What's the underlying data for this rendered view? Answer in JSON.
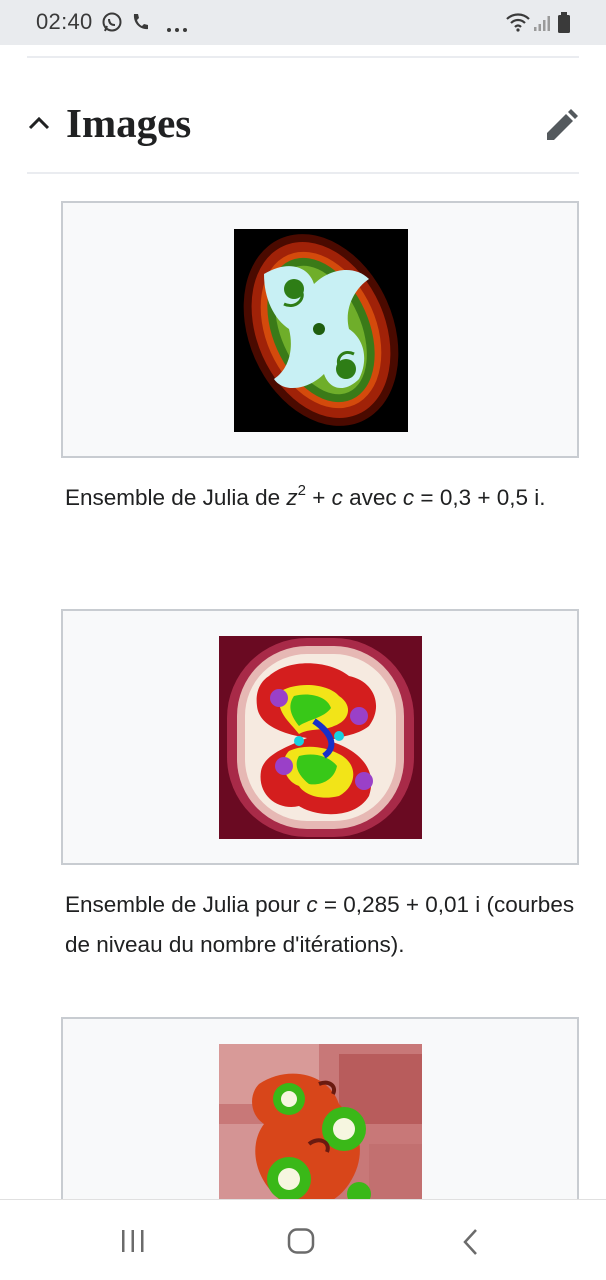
{
  "status_bar": {
    "time": "02:40",
    "icons": [
      "whatsapp-icon",
      "phone-icon",
      "more-dots-icon",
      "wifi-icon",
      "signal-icon",
      "battery-icon"
    ]
  },
  "section": {
    "title": "Images",
    "collapse_icon": "chevron-up-icon",
    "edit_icon": "pencil-icon"
  },
  "gallery": [
    {
      "image": "julia-set-1",
      "caption_parts": [
        "Ensemble de Julia de ",
        "z",
        "2",
        " + ",
        "c",
        " avec ",
        "c",
        " = 0,3 + 0,5 i."
      ]
    },
    {
      "image": "julia-set-2",
      "caption_parts": [
        "Ensemble de Julia pour ",
        "c",
        " = 0,285 + 0,01 i (courbes de niveau du nombre d'itérations)."
      ]
    },
    {
      "image": "julia-set-3",
      "caption_parts": []
    }
  ],
  "nav_bar": {
    "buttons": [
      "recent-apps-icon",
      "home-icon",
      "back-icon"
    ]
  },
  "colors": {
    "status_bg": "#e9ebee",
    "thumb_bg": "#f8f9fa",
    "thumb_border": "#c8ccd1",
    "divider": "#eaecf0",
    "text": "#202122"
  }
}
